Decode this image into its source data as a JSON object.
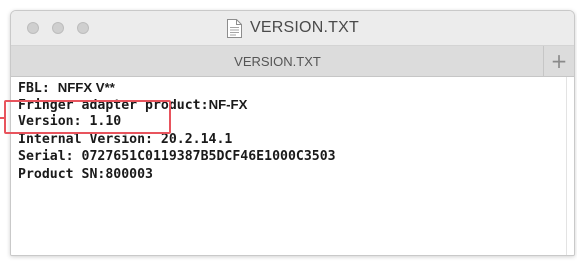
{
  "window": {
    "title": "VERSION.TXT",
    "title_icon": "text-document-icon",
    "buttons": [
      "close",
      "minimize",
      "zoom"
    ]
  },
  "tabs": {
    "items": [
      {
        "label": "VERSION.TXT"
      }
    ],
    "add_icon": "plus-icon",
    "add_label": "+"
  },
  "document": {
    "lines": [
      {
        "key": "FBL: ",
        "value": "NFFX V**"
      },
      {
        "key": "Fringer adapter product:",
        "value": "NF-FX"
      },
      {
        "key": "Version: 1.10",
        "value": ""
      },
      {
        "key": "Internal Version: 20.2.14.1",
        "value": ""
      },
      {
        "key": "Serial: 0727651C0119387B5DCF46E1000C3503",
        "value": ""
      },
      {
        "key": "Product SN:800003",
        "value": ""
      }
    ]
  },
  "annotation": {
    "highlight_color": "#e8545d",
    "highlighted_line": "Version: 1.10"
  }
}
